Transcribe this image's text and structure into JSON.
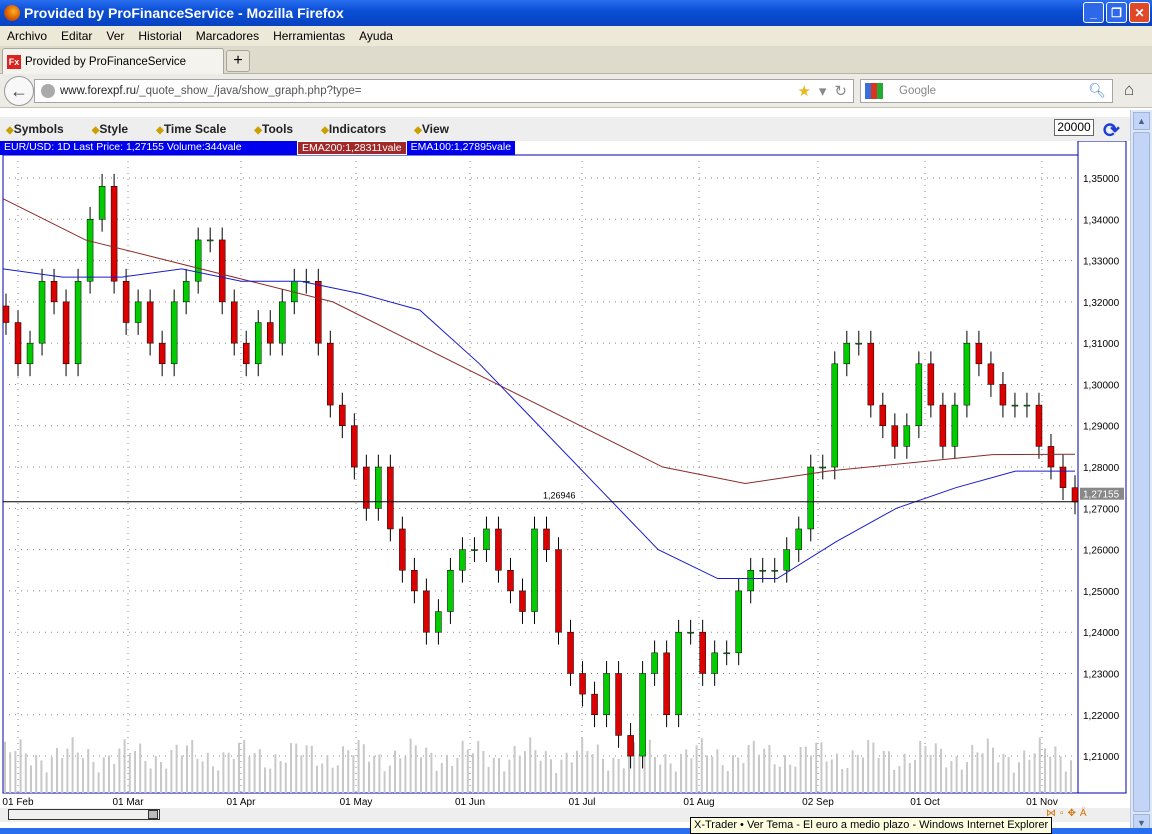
{
  "window": {
    "title": "Provided by ProFinanceService - Mozilla Firefox"
  },
  "menu": [
    "Archivo",
    "Editar",
    "Ver",
    "Historial",
    "Marcadores",
    "Herramientas",
    "Ayuda"
  ],
  "tab": {
    "label": "Provided by ProFinanceService",
    "icon_text": "Fx"
  },
  "address": {
    "host": "www.forexpf.ru",
    "path": "/_quote_show_/java/show_graph.php?type="
  },
  "search": {
    "placeholder": "Google"
  },
  "app_menu": [
    "Symbols",
    "Style",
    "Time Scale",
    "Tools",
    "Indicators",
    "View"
  ],
  "zoom_value": "20000",
  "info": {
    "main": "EUR/USD: 1D Last Price: 1,27155 Volume:344vale",
    "ema200": "EMA200:1,28311vale",
    "ema100": "EMA100:1,27895vale"
  },
  "tooltip": "X-Trader • Ver Tema - El euro a medio plazo - Windows Internet Explorer",
  "chart_data": {
    "type": "candlestick",
    "symbol": "EUR/USD",
    "timeframe": "1D",
    "ylim": [
      1.205,
      1.3545
    ],
    "yticks": [
      "1,35000",
      "1,34000",
      "1,33000",
      "1,32000",
      "1,31000",
      "1,30000",
      "1,29000",
      "1,28000",
      "1,27000",
      "1,26000",
      "1,25000",
      "1,24000",
      "1,23000",
      "1,22000",
      "1,21000"
    ],
    "ytick_values": [
      1.35,
      1.34,
      1.33,
      1.32,
      1.31,
      1.3,
      1.29,
      1.28,
      1.27,
      1.26,
      1.25,
      1.24,
      1.23,
      1.22,
      1.21
    ],
    "xticks": [
      "01 Feb",
      "01 Mar",
      "01 Apr",
      "01 May",
      "01 Jun",
      "01 Jul",
      "01 Aug",
      "02 Sep",
      "01 Oct",
      "01 Nov"
    ],
    "closes": [
      1.315,
      1.305,
      1.31,
      1.325,
      1.32,
      1.305,
      1.325,
      1.34,
      1.348,
      1.325,
      1.315,
      1.32,
      1.31,
      1.305,
      1.32,
      1.325,
      1.335,
      1.335,
      1.32,
      1.31,
      1.305,
      1.315,
      1.31,
      1.32,
      1.325,
      1.325,
      1.31,
      1.295,
      1.29,
      1.28,
      1.27,
      1.28,
      1.265,
      1.255,
      1.25,
      1.24,
      1.245,
      1.255,
      1.26,
      1.26,
      1.265,
      1.255,
      1.25,
      1.245,
      1.265,
      1.26,
      1.24,
      1.23,
      1.225,
      1.22,
      1.23,
      1.215,
      1.21,
      1.23,
      1.235,
      1.22,
      1.24,
      1.24,
      1.23,
      1.235,
      1.235,
      1.25,
      1.255,
      1.255,
      1.255,
      1.26,
      1.265,
      1.28,
      1.28,
      1.305,
      1.31,
      1.31,
      1.295,
      1.29,
      1.285,
      1.29,
      1.305,
      1.295,
      1.285,
      1.295,
      1.31,
      1.305,
      1.3,
      1.295,
      1.295,
      1.295,
      1.285,
      1.28,
      1.275,
      1.27155
    ],
    "series": [
      {
        "name": "EMA200",
        "color": "#8b2a2a",
        "values": [
          1.345,
          1.335,
          1.33,
          1.325,
          1.32,
          1.31,
          1.3,
          1.29,
          1.28,
          1.276,
          1.279,
          1.281,
          1.283,
          1.2831
        ]
      },
      {
        "name": "EMA100",
        "color": "#1a1acc",
        "values": [
          1.328,
          1.326,
          1.326,
          1.328,
          1.325,
          1.325,
          1.322,
          1.318,
          1.305,
          1.29,
          1.275,
          1.26,
          1.253,
          1.253,
          1.262,
          1.27,
          1.275,
          1.279,
          1.279
        ]
      }
    ],
    "last_price": "1,27155",
    "last_price_value": 1.2716,
    "annotation": "1,26946",
    "colors": {
      "up": "#00cc00",
      "down": "#dd0000",
      "axis": "#0000aa"
    }
  }
}
